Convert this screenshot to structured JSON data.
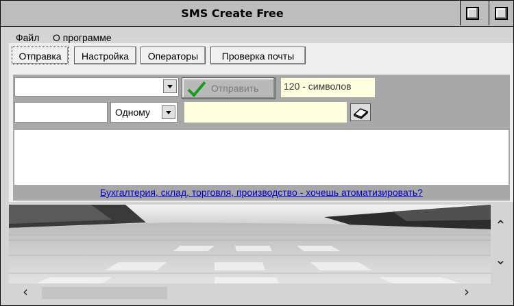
{
  "window": {
    "title": "SMS Create Free"
  },
  "menu": {
    "items": [
      "Файл",
      "О программе"
    ]
  },
  "tabs": [
    {
      "label": "Отправка",
      "active": true
    },
    {
      "label": "Настройка",
      "active": false
    },
    {
      "label": "Операторы",
      "active": false
    },
    {
      "label": "Проверка почты",
      "active": false
    }
  ],
  "send_form": {
    "recipient_value": "",
    "send_label": "Отправить",
    "counter_text": "120 - символов",
    "number_value": "",
    "mode_value": "Одному",
    "sender_value": "",
    "message_value": ""
  },
  "ad_link": "Бухгалтерия, склад, торговля, производство - хочешь атоматизировать?",
  "icons": [
    "checkmark-icon",
    "book-icon",
    "chevron-up-icon",
    "chevron-down-icon",
    "chevron-left-icon",
    "chevron-right-icon"
  ],
  "colors": {
    "link": "#0000cc",
    "highlight_field": "#ffffe0",
    "check_green": "#1a9a1a"
  }
}
